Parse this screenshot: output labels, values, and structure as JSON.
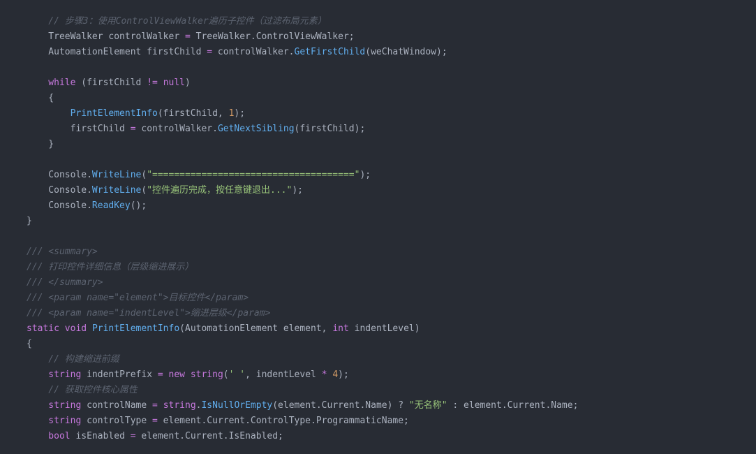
{
  "colors": {
    "background": "#282c34",
    "plain": "#abb2bf",
    "keyword": "#c678dd",
    "method": "#61aeee",
    "string": "#98c379",
    "number": "#d19a66",
    "comment": "#5c6370"
  },
  "code": {
    "lines": [
      [
        {
          "t": "comment",
          "v": "    // 步骤3：使用ControlViewWalker遍历子控件（过滤布局元素）"
        }
      ],
      [
        {
          "t": "plain",
          "v": "    TreeWalker controlWalker "
        },
        {
          "t": "operator",
          "v": "="
        },
        {
          "t": "plain",
          "v": " TreeWalker.ControlViewWalker;"
        }
      ],
      [
        {
          "t": "plain",
          "v": "    AutomationElement firstChild "
        },
        {
          "t": "operator",
          "v": "="
        },
        {
          "t": "plain",
          "v": " controlWalker."
        },
        {
          "t": "method",
          "v": "GetFirstChild"
        },
        {
          "t": "plain",
          "v": "(weChatWindow);"
        }
      ],
      [],
      [
        {
          "t": "keyword",
          "v": "    while"
        },
        {
          "t": "plain",
          "v": " (firstChild "
        },
        {
          "t": "operator",
          "v": "!="
        },
        {
          "t": "plain",
          "v": " "
        },
        {
          "t": "keyword",
          "v": "null"
        },
        {
          "t": "plain",
          "v": ")"
        }
      ],
      [
        {
          "t": "plain",
          "v": "    {"
        }
      ],
      [
        {
          "t": "method",
          "v": "        PrintElementInfo"
        },
        {
          "t": "plain",
          "v": "(firstChild, "
        },
        {
          "t": "number",
          "v": "1"
        },
        {
          "t": "plain",
          "v": ");"
        }
      ],
      [
        {
          "t": "plain",
          "v": "        firstChild "
        },
        {
          "t": "operator",
          "v": "="
        },
        {
          "t": "plain",
          "v": " controlWalker."
        },
        {
          "t": "method",
          "v": "GetNextSibling"
        },
        {
          "t": "plain",
          "v": "(firstChild);"
        }
      ],
      [
        {
          "t": "plain",
          "v": "    }"
        }
      ],
      [],
      [
        {
          "t": "plain",
          "v": "    Console."
        },
        {
          "t": "method",
          "v": "WriteLine"
        },
        {
          "t": "plain",
          "v": "("
        },
        {
          "t": "string",
          "v": "\"=====================================\""
        },
        {
          "t": "plain",
          "v": ");"
        }
      ],
      [
        {
          "t": "plain",
          "v": "    Console."
        },
        {
          "t": "method",
          "v": "WriteLine"
        },
        {
          "t": "plain",
          "v": "("
        },
        {
          "t": "string",
          "v": "\"控件遍历完成，按任意键退出...\""
        },
        {
          "t": "plain",
          "v": ");"
        }
      ],
      [
        {
          "t": "plain",
          "v": "    Console."
        },
        {
          "t": "method",
          "v": "ReadKey"
        },
        {
          "t": "plain",
          "v": "();"
        }
      ],
      [
        {
          "t": "plain",
          "v": "}"
        }
      ],
      [],
      [
        {
          "t": "comment",
          "v": "/// <summary>"
        }
      ],
      [
        {
          "t": "comment",
          "v": "/// 打印控件详细信息（层级缩进展示）"
        }
      ],
      [
        {
          "t": "comment",
          "v": "/// </summary>"
        }
      ],
      [
        {
          "t": "comment",
          "v": "/// <param name=\"element\">目标控件</param>"
        }
      ],
      [
        {
          "t": "comment",
          "v": "/// <param name=\"indentLevel\">缩进层级</param>"
        }
      ],
      [
        {
          "t": "keyword",
          "v": "static"
        },
        {
          "t": "plain",
          "v": " "
        },
        {
          "t": "keyword",
          "v": "void"
        },
        {
          "t": "plain",
          "v": " "
        },
        {
          "t": "method",
          "v": "PrintElementInfo"
        },
        {
          "t": "plain",
          "v": "(AutomationElement element, "
        },
        {
          "t": "keyword",
          "v": "int"
        },
        {
          "t": "plain",
          "v": " indentLevel)"
        }
      ],
      [
        {
          "t": "plain",
          "v": "{"
        }
      ],
      [
        {
          "t": "comment",
          "v": "    // 构建缩进前缀"
        }
      ],
      [
        {
          "t": "keyword",
          "v": "    string"
        },
        {
          "t": "plain",
          "v": " indentPrefix "
        },
        {
          "t": "operator",
          "v": "="
        },
        {
          "t": "plain",
          "v": " "
        },
        {
          "t": "keyword",
          "v": "new"
        },
        {
          "t": "plain",
          "v": " "
        },
        {
          "t": "keyword",
          "v": "string"
        },
        {
          "t": "plain",
          "v": "("
        },
        {
          "t": "string",
          "v": "' '"
        },
        {
          "t": "plain",
          "v": ", indentLevel "
        },
        {
          "t": "operator",
          "v": "*"
        },
        {
          "t": "plain",
          "v": " "
        },
        {
          "t": "number",
          "v": "4"
        },
        {
          "t": "plain",
          "v": ");"
        }
      ],
      [
        {
          "t": "comment",
          "v": "    // 获取控件核心属性"
        }
      ],
      [
        {
          "t": "keyword",
          "v": "    string"
        },
        {
          "t": "plain",
          "v": " controlName "
        },
        {
          "t": "operator",
          "v": "="
        },
        {
          "t": "plain",
          "v": " "
        },
        {
          "t": "keyword",
          "v": "string"
        },
        {
          "t": "plain",
          "v": "."
        },
        {
          "t": "method",
          "v": "IsNullOrEmpty"
        },
        {
          "t": "plain",
          "v": "(element.Current.Name) ? "
        },
        {
          "t": "string",
          "v": "\"无名称\""
        },
        {
          "t": "plain",
          "v": " : element.Current.Name;"
        }
      ],
      [
        {
          "t": "keyword",
          "v": "    string"
        },
        {
          "t": "plain",
          "v": " controlType "
        },
        {
          "t": "operator",
          "v": "="
        },
        {
          "t": "plain",
          "v": " element.Current.ControlType.ProgrammaticName;"
        }
      ],
      [
        {
          "t": "keyword",
          "v": "    bool"
        },
        {
          "t": "plain",
          "v": " isEnabled "
        },
        {
          "t": "operator",
          "v": "="
        },
        {
          "t": "plain",
          "v": " element.Current.IsEnabled;"
        }
      ]
    ]
  }
}
